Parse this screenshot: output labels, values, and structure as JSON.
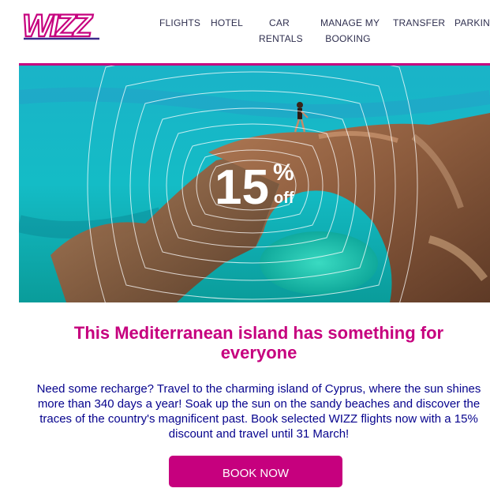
{
  "brand": {
    "logo_text": "WIZZ",
    "primary_color": "#c6007e",
    "text_color": "#06038d",
    "nav_color": "#2f2f4f"
  },
  "nav": {
    "flights": "FLIGHTS",
    "hotel": "HOTEL",
    "car_rentals_line1": "CAR",
    "car_rentals_line2": "RENTALS",
    "manage_line1": "MANAGE MY",
    "manage_line2": "BOOKING",
    "transfer": "TRANSFER",
    "parking": "PARKING"
  },
  "hero": {
    "discount_number": "15",
    "discount_percent": "%",
    "discount_off": "off",
    "image_subject": "Cyprus sea arch with turquoise water"
  },
  "content": {
    "headline": "This Mediterranean island has something for everyone",
    "body": "Need some recharge? Travel to the charming island of Cyprus, where the sun shines more than 340 days a year! Soak up the sun on the sandy beaches and discover the traces of the country's magnificent past. Book selected WIZZ flights now with a 15% discount and travel until 31 March!",
    "cta_label": "BOOK NOW"
  }
}
